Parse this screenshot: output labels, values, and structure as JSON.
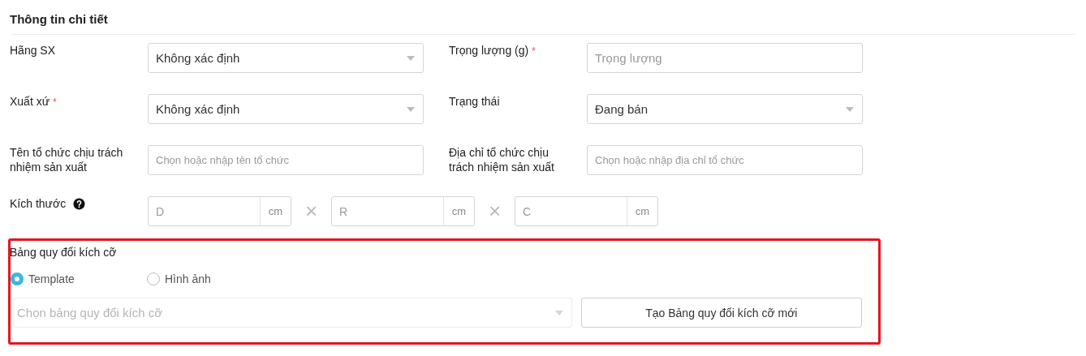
{
  "title": "Thông tin chi tiết",
  "rows": [
    [
      {
        "label": "Hãng SX",
        "kind": "select",
        "value": "Không xác định"
      },
      {
        "label": "Trọng lượng (g)",
        "required_mark": "*",
        "kind": "input",
        "placeholder": "Trọng lượng"
      }
    ],
    [
      {
        "label": "Xuất xứ",
        "required_mark": "*",
        "kind": "select",
        "value": "Không xác định"
      },
      {
        "label": "Trạng thái",
        "kind": "select",
        "value": "Đang bán"
      }
    ],
    [
      {
        "label": "Tên tổ chức chịu trách nhiệm sản xuất",
        "kind": "small_input",
        "placeholder": "Chọn hoặc nhập tên tổ chức"
      },
      {
        "label": "Địa chỉ tổ chức chịu trách nhiệm sản xuất",
        "kind": "small_input",
        "placeholder": "Chọn hoặc nhập địa chỉ tổ chức"
      }
    ]
  ],
  "dimensions": {
    "label": "Kích thước",
    "separator": "×",
    "inputs": [
      {
        "placeholder": "D",
        "unit": "cm"
      },
      {
        "placeholder": "R",
        "unit": "cm"
      },
      {
        "placeholder": "C",
        "unit": "cm"
      }
    ]
  },
  "size_chart": {
    "highlighted": true,
    "label": "Bảng quy đổi kích cỡ",
    "options": [
      {
        "label": "Template",
        "selected": true
      },
      {
        "label": "Hình ảnh",
        "selected": false
      }
    ],
    "select": {
      "placeholder": "Chọn bảng quy đổi kích cỡ",
      "disabled": true
    },
    "button": "Tạo Bảng quy đổi kích cỡ mới"
  }
}
